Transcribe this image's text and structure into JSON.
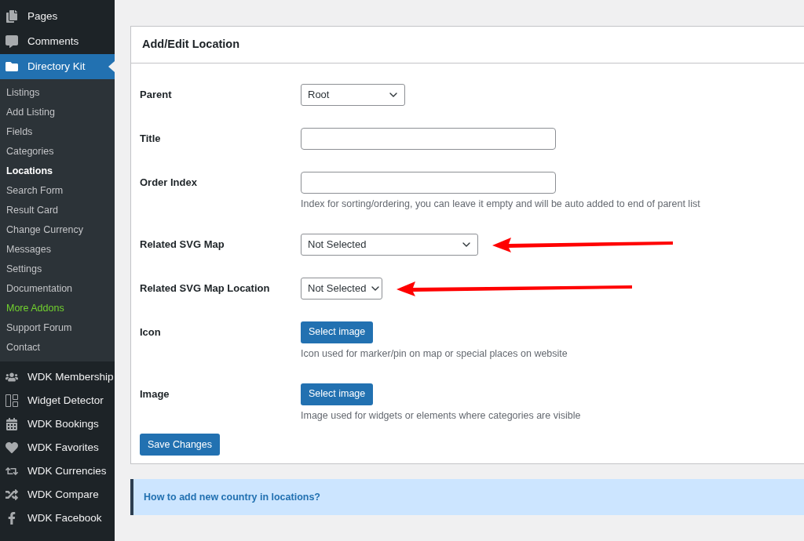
{
  "sidebar": {
    "top_items": [
      {
        "label": "Pages",
        "selected": false
      },
      {
        "label": "Comments",
        "selected": false
      },
      {
        "label": "Directory Kit",
        "selected": true
      }
    ],
    "submenu": [
      {
        "label": "Listings",
        "selected": false,
        "accent": false
      },
      {
        "label": "Add Listing",
        "selected": false,
        "accent": false
      },
      {
        "label": "Fields",
        "selected": false,
        "accent": false
      },
      {
        "label": "Categories",
        "selected": false,
        "accent": false
      },
      {
        "label": "Locations",
        "selected": true,
        "accent": false
      },
      {
        "label": "Search Form",
        "selected": false,
        "accent": false
      },
      {
        "label": "Result Card",
        "selected": false,
        "accent": false
      },
      {
        "label": "Change Currency",
        "selected": false,
        "accent": false
      },
      {
        "label": "Messages",
        "selected": false,
        "accent": false
      },
      {
        "label": "Settings",
        "selected": false,
        "accent": false
      },
      {
        "label": "Documentation",
        "selected": false,
        "accent": false
      },
      {
        "label": "More Addons",
        "selected": false,
        "accent": true
      },
      {
        "label": "Support Forum",
        "selected": false,
        "accent": false
      },
      {
        "label": "Contact",
        "selected": false,
        "accent": false
      }
    ],
    "bottom_items": [
      {
        "label": "WDK Membership",
        "selected": false
      },
      {
        "label": "Widget Detector",
        "selected": false
      },
      {
        "label": "WDK Bookings",
        "selected": false
      },
      {
        "label": "WDK Favorites",
        "selected": false
      },
      {
        "label": "WDK Currencies",
        "selected": false
      },
      {
        "label": "WDK Compare",
        "selected": false
      },
      {
        "label": "WDK Facebook",
        "selected": false
      }
    ]
  },
  "card": {
    "title": "Add/Edit Location",
    "fields": [
      {
        "label": "Parent",
        "kind": "select",
        "value": "Root",
        "pointed": false
      },
      {
        "label": "Title",
        "kind": "text",
        "pointed": false
      },
      {
        "label": "Order Index",
        "kind": "text",
        "description": "Index for sorting/ordering, you can leave it empty and will be auto added to end of parent list",
        "pointed": false
      },
      {
        "label": "Related SVG Map",
        "kind": "select",
        "value": "Not Selected",
        "pointed": true
      },
      {
        "label": "Related SVG Map Location",
        "kind": "select",
        "value": "Not Selected",
        "pointed": true
      },
      {
        "label": "Icon",
        "kind": "image",
        "button": "Select image",
        "description": "Icon used for marker/pin on map or special places on website",
        "pointed": false
      },
      {
        "label": "Image",
        "kind": "image",
        "button": "Select image",
        "description": "Image used for widgets or elements where categories are visible",
        "pointed": false
      }
    ],
    "save_button": "Save Changes"
  },
  "notice": {
    "link": "How to add new country in locations?"
  }
}
